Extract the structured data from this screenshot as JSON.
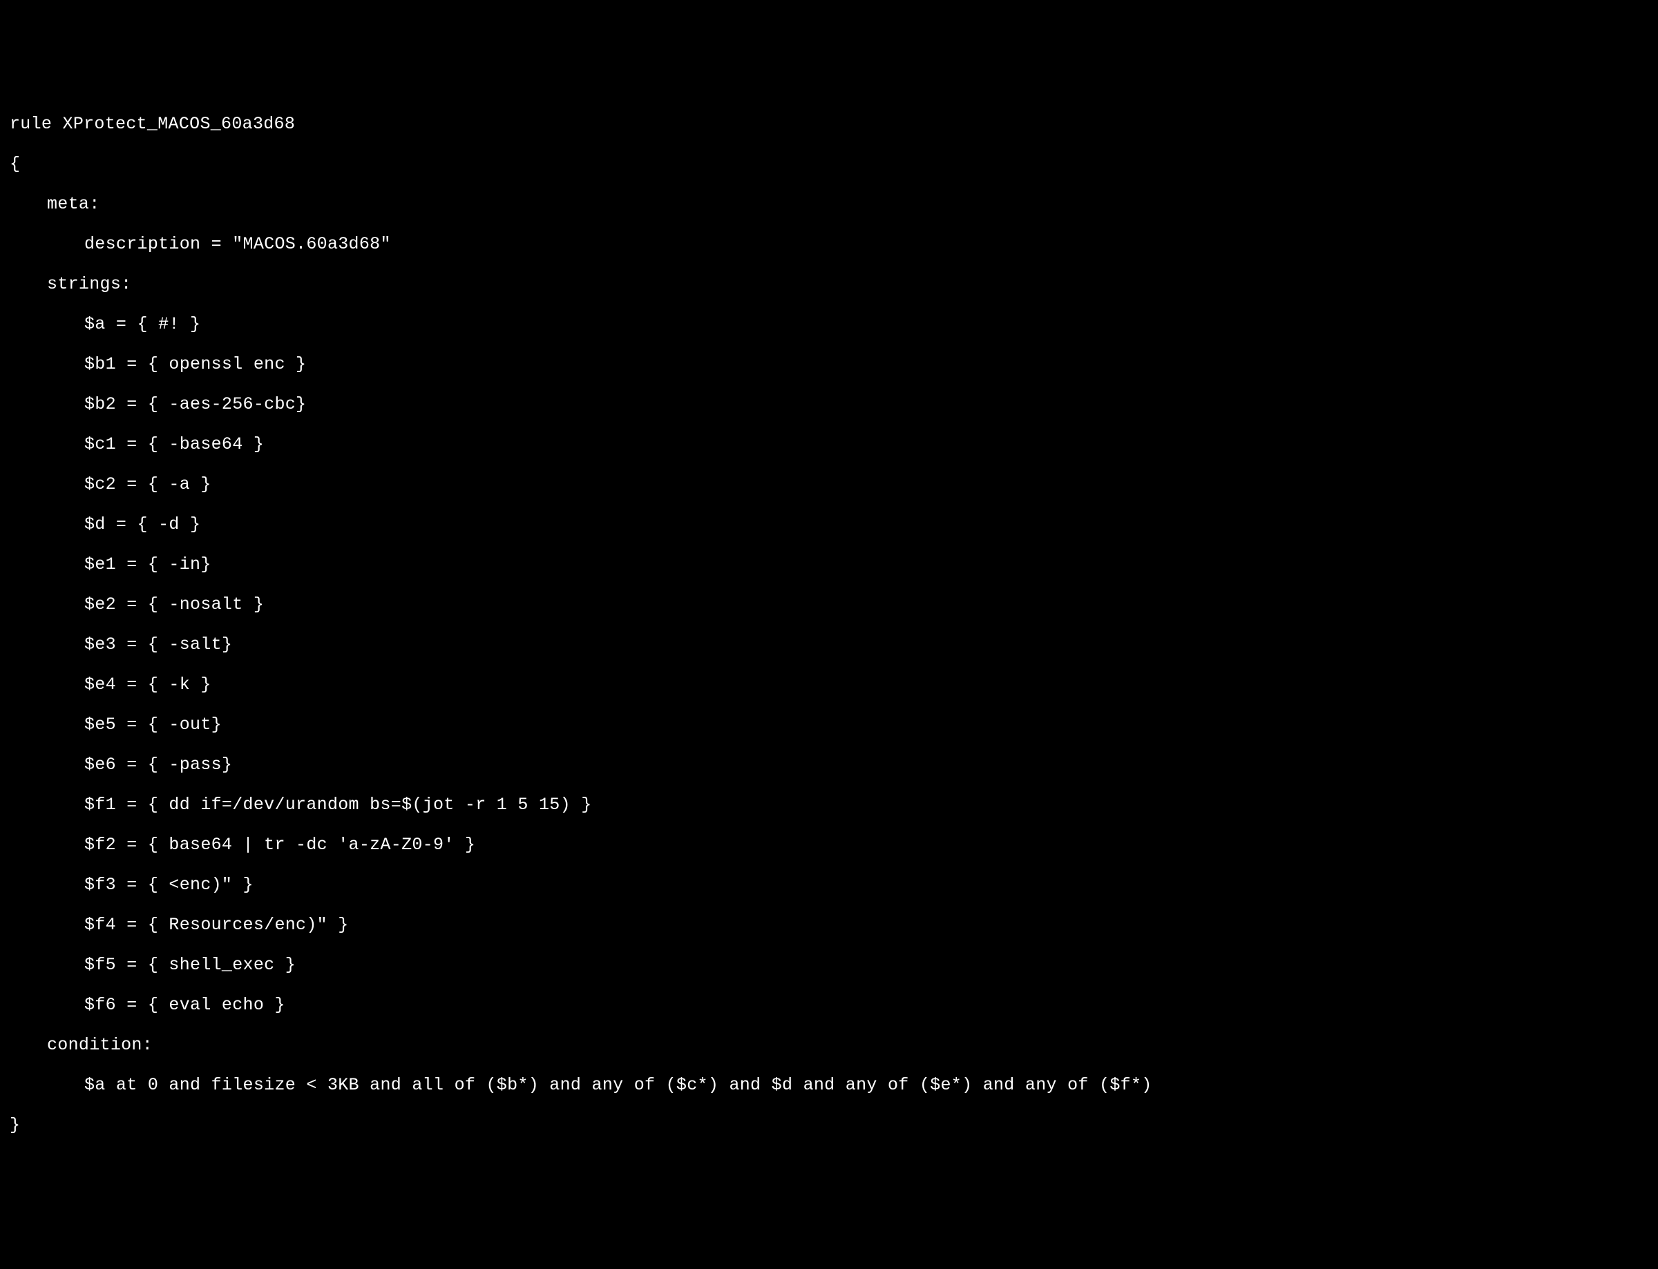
{
  "code": {
    "line1": "rule XProtect_MACOS_60a3d68",
    "line2": "{",
    "line3": "meta:",
    "line4": "description = \"MACOS.60a3d68\"",
    "line5": "strings:",
    "line6": "$a = { #! }",
    "line7": "$b1 = { openssl enc }",
    "line8": "$b2 = { -aes-256-cbc}",
    "line9": "$c1 = { -base64 }",
    "line10": "$c2 = { -a }",
    "line11": "$d = { -d }",
    "line12": "$e1 = { -in}",
    "line13": "$e2 = { -nosalt }",
    "line14": "$e3 = { -salt}",
    "line15": "$e4 = { -k }",
    "line16": "$e5 = { -out}",
    "line17": "$e6 = { -pass}",
    "line18": "$f1 = { dd if=/dev/urandom bs=$(jot -r 1 5 15) }",
    "line19": "$f2 = { base64 | tr -dc 'a-zA-Z0-9' }",
    "line20": "$f3 = { <enc)\" }",
    "line21": "$f4 = { Resources/enc)\" }",
    "line22": "$f5 = { shell_exec }",
    "line23": "$f6 = { eval echo }",
    "line24": "condition:",
    "line25": "$a at 0 and filesize < 3KB and all of ($b*) and any of ($c*) and $d and any of ($e*) and any of ($f*)",
    "line26": "}"
  }
}
